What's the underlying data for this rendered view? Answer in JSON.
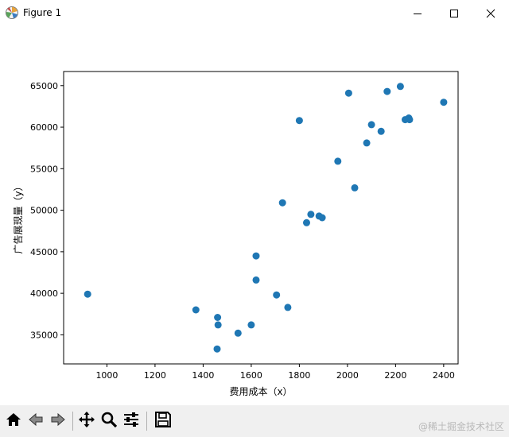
{
  "window": {
    "title": "Figure 1",
    "icon": "matplotlib-icon",
    "buttons": [
      "minimize-icon",
      "maximize-icon",
      "close-icon"
    ]
  },
  "toolbar": {
    "buttons": [
      "home-icon",
      "back-icon",
      "forward-icon",
      "pan-icon",
      "zoom-icon",
      "configure-subplots-icon",
      "save-icon"
    ],
    "watermark": "@稀土掘金技术社区"
  },
  "chart_data": {
    "type": "scatter",
    "xlabel": "费用成本（x）",
    "ylabel": "广告展现量（y）",
    "xlim": [
      820,
      2460
    ],
    "ylim": [
      31500,
      66700
    ],
    "xticks": [
      1000,
      1200,
      1400,
      1600,
      1800,
      2000,
      2200,
      2400
    ],
    "yticks": [
      35000,
      40000,
      45000,
      50000,
      55000,
      60000,
      65000
    ],
    "grid": false,
    "color": "#1f77b4",
    "points": [
      [
        920,
        39900
      ],
      [
        1370,
        38000
      ],
      [
        1460,
        37100
      ],
      [
        1462,
        36200
      ],
      [
        1458,
        33300
      ],
      [
        1545,
        35200
      ],
      [
        1600,
        36200
      ],
      [
        1620,
        44500
      ],
      [
        1620,
        41600
      ],
      [
        1705,
        39800
      ],
      [
        1730,
        50900
      ],
      [
        1752,
        38300
      ],
      [
        1800,
        60800
      ],
      [
        1830,
        48500
      ],
      [
        1848,
        49500
      ],
      [
        1882,
        49300
      ],
      [
        1895,
        49100
      ],
      [
        1960,
        55900
      ],
      [
        2005,
        64100
      ],
      [
        2030,
        52700
      ],
      [
        2080,
        58100
      ],
      [
        2100,
        60300
      ],
      [
        2140,
        59500
      ],
      [
        2165,
        64300
      ],
      [
        2220,
        64900
      ],
      [
        2240,
        60900
      ],
      [
        2255,
        61100
      ],
      [
        2258,
        60900
      ],
      [
        2400,
        63000
      ]
    ]
  }
}
